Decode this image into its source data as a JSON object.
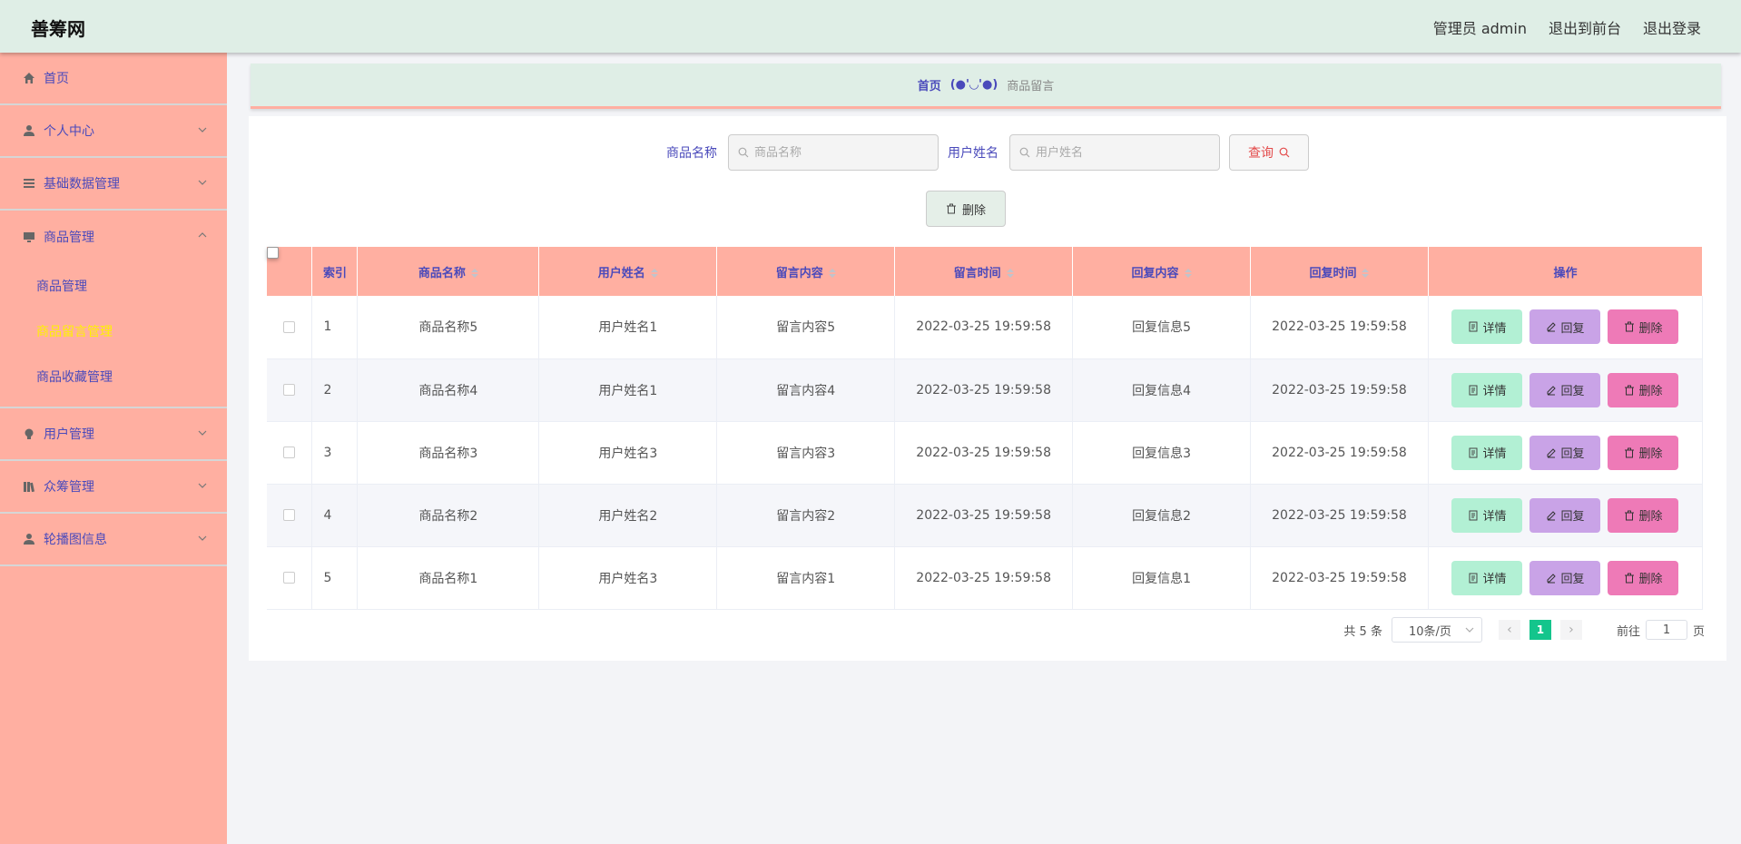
{
  "header": {
    "logo": "善筹网",
    "admin": "管理员 admin",
    "to_front": "退出到前台",
    "logout": "退出登录"
  },
  "sidebar": {
    "items": [
      {
        "label": "首页",
        "icon": "home-icon"
      },
      {
        "label": "个人中心",
        "icon": "user-icon"
      },
      {
        "label": "基础数据管理",
        "icon": "list-icon"
      },
      {
        "label": "商品管理",
        "icon": "monitor-icon"
      },
      {
        "label": "用户管理",
        "icon": "bulb-icon"
      },
      {
        "label": "众筹管理",
        "icon": "books-icon"
      },
      {
        "label": "轮播图信息",
        "icon": "user-icon"
      }
    ],
    "sub_items": [
      {
        "label": "商品管理",
        "active": false
      },
      {
        "label": "商品留言管理",
        "active": true
      },
      {
        "label": "商品收藏管理",
        "active": false
      }
    ],
    "active_color": "#fff200"
  },
  "breadcrumb": {
    "home": "首页",
    "sep": "(●'◡'●)",
    "current": "商品留言"
  },
  "search": {
    "product_label": "商品名称",
    "product_placeholder": "商品名称",
    "user_label": "用户姓名",
    "user_placeholder": "用户姓名",
    "query": "查询"
  },
  "bulk_delete": "删除",
  "table": {
    "headers": [
      "索引",
      "商品名称",
      "用户姓名",
      "留言内容",
      "留言时间",
      "回复内容",
      "回复时间",
      "操作"
    ],
    "rows": [
      {
        "idx": "1",
        "product": "商品名称5",
        "user": "用户姓名1",
        "content": "留言内容5",
        "time": "2022-03-25 19:59:58",
        "reply": "回复信息5",
        "reply_time": "2022-03-25 19:59:58"
      },
      {
        "idx": "2",
        "product": "商品名称4",
        "user": "用户姓名1",
        "content": "留言内容4",
        "time": "2022-03-25 19:59:58",
        "reply": "回复信息4",
        "reply_time": "2022-03-25 19:59:58"
      },
      {
        "idx": "3",
        "product": "商品名称3",
        "user": "用户姓名3",
        "content": "留言内容3",
        "time": "2022-03-25 19:59:58",
        "reply": "回复信息3",
        "reply_time": "2022-03-25 19:59:58"
      },
      {
        "idx": "4",
        "product": "商品名称2",
        "user": "用户姓名2",
        "content": "留言内容2",
        "time": "2022-03-25 19:59:58",
        "reply": "回复信息2",
        "reply_time": "2022-03-25 19:59:58"
      },
      {
        "idx": "5",
        "product": "商品名称1",
        "user": "用户姓名3",
        "content": "留言内容1",
        "time": "2022-03-25 19:59:58",
        "reply": "回复信息1",
        "reply_time": "2022-03-25 19:59:58"
      }
    ],
    "ops": {
      "detail": "详情",
      "reply": "回复",
      "delete": "删除"
    }
  },
  "pagination": {
    "total": "共 5 条",
    "page_size": "10条/页",
    "current": "1",
    "goto_prefix": "前往",
    "goto_value": "1",
    "goto_suffix": "页"
  },
  "colors": {
    "sidebar_bg": "#ffafa1",
    "header_bg": "#dfeee6",
    "accent_text": "#4a4abb",
    "page_active": "#14c58c"
  }
}
